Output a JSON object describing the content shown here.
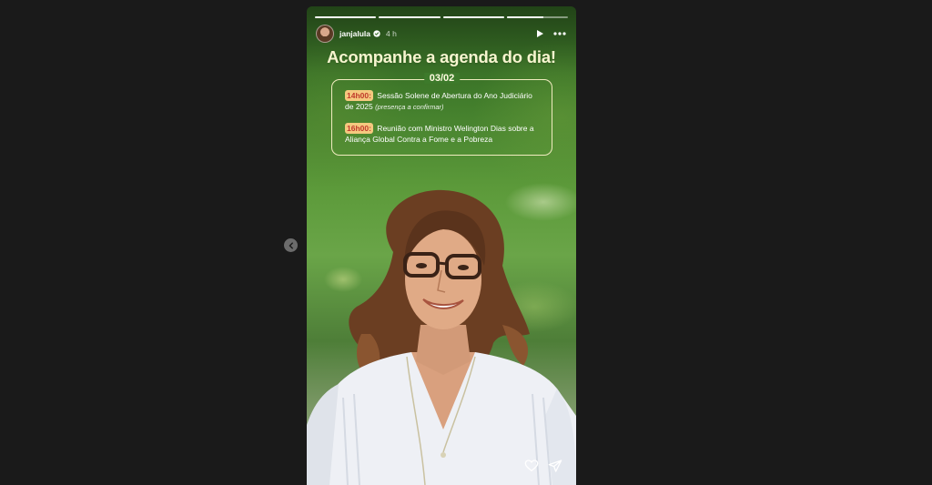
{
  "story": {
    "username": "janjalula",
    "verified": true,
    "time": "4 h",
    "segments": [
      {
        "progress": 1.0
      },
      {
        "progress": 1.0
      },
      {
        "progress": 1.0
      },
      {
        "progress": 0.6
      }
    ],
    "headline": "Acompanhe a agenda do dia!",
    "agenda": {
      "date": "03/02",
      "items": [
        {
          "time": "14h00:",
          "text": " Sessão Solene de Abertura do Ano Judiciário de 2025 ",
          "note": "(presença a confirmar)"
        },
        {
          "time": "16h00:",
          "text": " Reunião com Ministro Welington Dias sobre a Aliança Global Contra a Fome e a Pobreza",
          "note": ""
        }
      ]
    }
  },
  "icons": {
    "play": "play-icon",
    "more": "more-icon",
    "heart": "heart-icon",
    "share": "send-icon",
    "prev": "chevron-left-icon",
    "verified": "verified-badge-icon"
  },
  "colors": {
    "background": "#1a1a1a",
    "headline": "#f7f5cf",
    "badge_bg": "#f5c97f",
    "badge_text": "#c0392b"
  }
}
